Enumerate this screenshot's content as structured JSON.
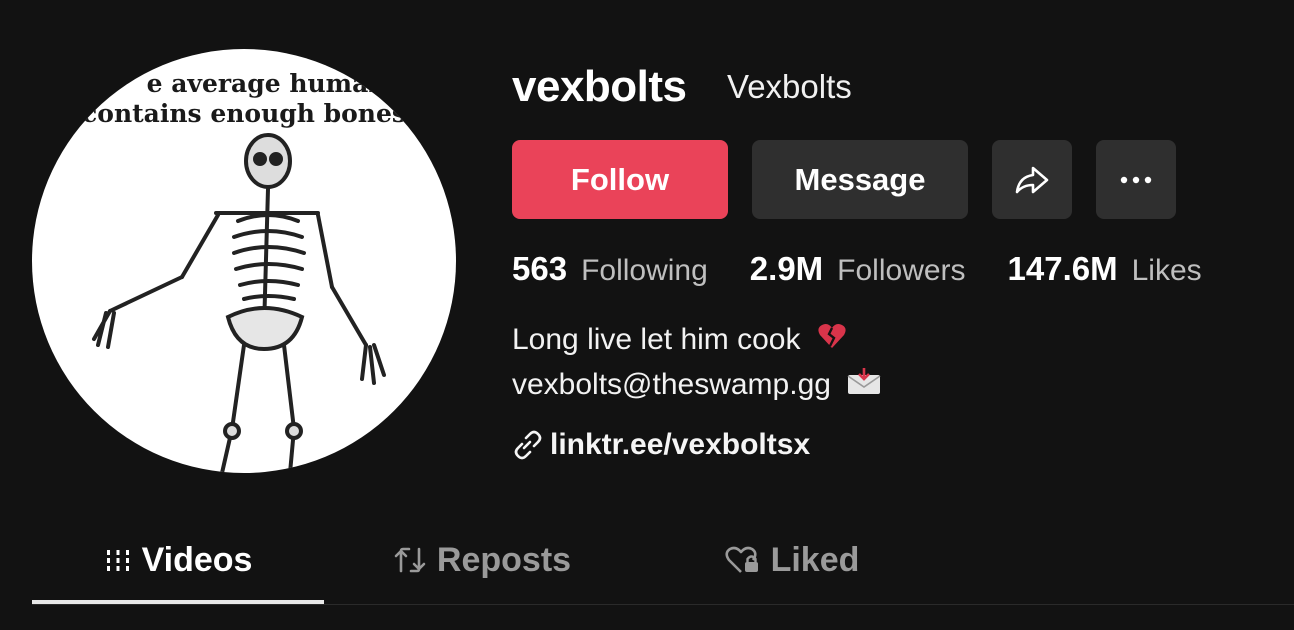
{
  "profile": {
    "username": "vexbolts",
    "nickname": "Vexbolts",
    "avatar_caption_line1": "e average human bo",
    "avatar_caption_line2": "contains enough bones"
  },
  "actions": {
    "follow_label": "Follow",
    "message_label": "Message",
    "share_icon": "share-arrow-icon",
    "more_icon": "ellipsis-icon"
  },
  "stats": {
    "following_count": "563",
    "following_label": "Following",
    "followers_count": "2.9M",
    "followers_label": "Followers",
    "likes_count": "147.6M",
    "likes_label": "Likes"
  },
  "bio": {
    "line1": "Long live let him cook",
    "line1_emoji": "💔",
    "line2": "vexbolts@theswamp.gg",
    "line2_emoji": "📩"
  },
  "link": {
    "text": "linktr.ee/vexboltsx",
    "icon": "link-icon"
  },
  "tabs": [
    {
      "label": "Videos",
      "icon": "grid-icon",
      "active": true
    },
    {
      "label": "Reposts",
      "icon": "repost-icon",
      "active": false
    },
    {
      "label": "Liked",
      "icon": "heart-lock-icon",
      "active": false
    }
  ],
  "colors": {
    "background": "#121212",
    "follow": "#ea4359",
    "secondary_button": "#2f2f2f",
    "muted_text": "#bfbfbf"
  }
}
